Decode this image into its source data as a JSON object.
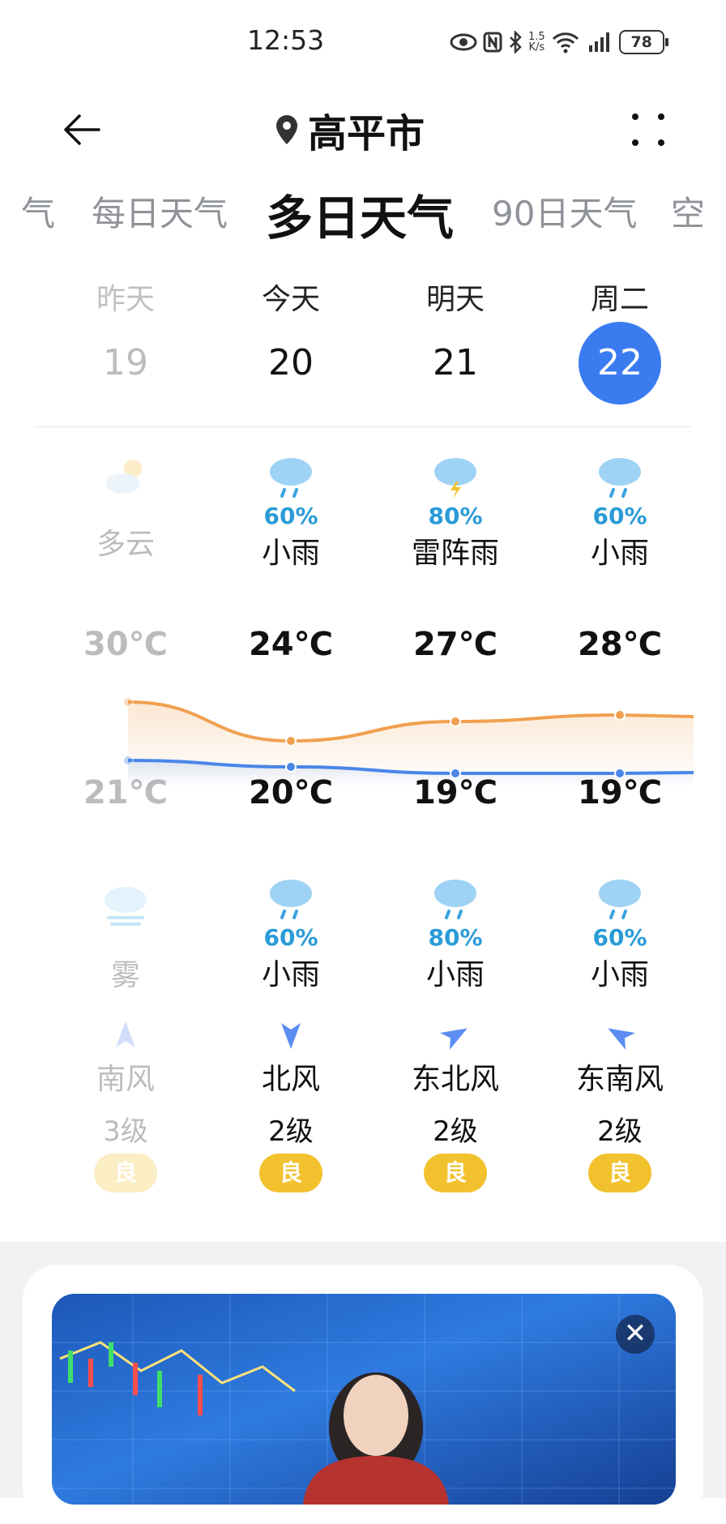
{
  "status": {
    "time": "12:53",
    "speed_value": "1.5",
    "speed_unit": "K/s",
    "battery": "78"
  },
  "header": {
    "city": "高平市"
  },
  "tabs": [
    {
      "label": "气",
      "active": false
    },
    {
      "label": "每日天气",
      "active": false
    },
    {
      "label": "多日天气",
      "active": true
    },
    {
      "label": "90日天气",
      "active": false
    },
    {
      "label": "空",
      "active": false
    }
  ],
  "days": [
    {
      "name": "昨天",
      "date": "19",
      "icon": "partly-cloudy-icon",
      "day_precip": "",
      "day_cond": "多云",
      "high": "30℃",
      "low": "21℃",
      "night_icon": "fog-icon",
      "night_precip": "",
      "night_cond": "雾",
      "wind_dir": "南风",
      "wind_level": "3级",
      "aqi": "良"
    },
    {
      "name": "今天",
      "date": "20",
      "icon": "light-rain-icon",
      "day_precip": "60%",
      "day_cond": "小雨",
      "high": "24℃",
      "low": "20℃",
      "night_icon": "light-rain-icon",
      "night_precip": "60%",
      "night_cond": "小雨",
      "wind_dir": "北风",
      "wind_level": "2级",
      "aqi": "良"
    },
    {
      "name": "明天",
      "date": "21",
      "icon": "thunderstorm-icon",
      "day_precip": "80%",
      "day_cond": "雷阵雨",
      "high": "27℃",
      "low": "19℃",
      "night_icon": "light-rain-icon",
      "night_precip": "80%",
      "night_cond": "小雨",
      "wind_dir": "东北风",
      "wind_level": "2级",
      "aqi": "良"
    },
    {
      "name": "周二",
      "date": "22",
      "icon": "light-rain-icon",
      "day_precip": "60%",
      "day_cond": "小雨",
      "high": "28℃",
      "low": "19℃",
      "night_icon": "light-rain-icon",
      "night_precip": "60%",
      "night_cond": "小雨",
      "wind_dir": "东南风",
      "wind_level": "2级",
      "aqi": "良"
    }
  ],
  "chart_data": {
    "type": "line",
    "categories": [
      "19",
      "20",
      "21",
      "22"
    ],
    "series": [
      {
        "name": "",
        "values": [
          30,
          24,
          27,
          28
        ],
        "color": "#f0a050"
      },
      {
        "name": "",
        "values": [
          21,
          20,
          19,
          19
        ],
        "color": "#4a86e8"
      }
    ]
  },
  "colors": {
    "accent": "#3a7bf0",
    "aqi_good": "#f2c12e",
    "precip": "#2a9bd7"
  },
  "ad": {
    "close_icon": "close-icon",
    "close_glyph": "✕"
  }
}
